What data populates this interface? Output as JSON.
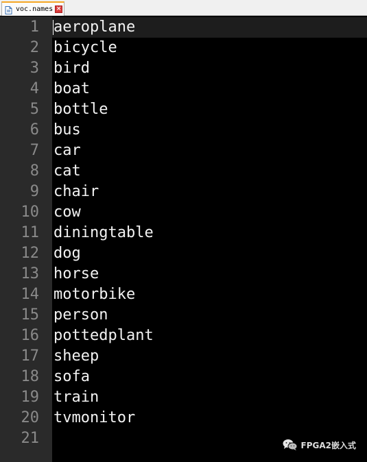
{
  "tab": {
    "filename": "voc.names",
    "icon": "file-icon",
    "close_icon": "close-icon",
    "close_glyph": "×"
  },
  "editor": {
    "lines": [
      {
        "number": "1",
        "text": "aeroplane"
      },
      {
        "number": "2",
        "text": "bicycle"
      },
      {
        "number": "3",
        "text": "bird"
      },
      {
        "number": "4",
        "text": "boat"
      },
      {
        "number": "5",
        "text": "bottle"
      },
      {
        "number": "6",
        "text": "bus"
      },
      {
        "number": "7",
        "text": "car"
      },
      {
        "number": "8",
        "text": "cat"
      },
      {
        "number": "9",
        "text": "chair"
      },
      {
        "number": "10",
        "text": "cow"
      },
      {
        "number": "11",
        "text": "diningtable"
      },
      {
        "number": "12",
        "text": "dog"
      },
      {
        "number": "13",
        "text": "horse"
      },
      {
        "number": "14",
        "text": "motorbike"
      },
      {
        "number": "15",
        "text": "person"
      },
      {
        "number": "16",
        "text": "pottedplant"
      },
      {
        "number": "17",
        "text": "sheep"
      },
      {
        "number": "18",
        "text": "sofa"
      },
      {
        "number": "19",
        "text": "train"
      },
      {
        "number": "20",
        "text": "tvmonitor"
      },
      {
        "number": "21",
        "text": ""
      }
    ],
    "current_line": 1,
    "colors": {
      "background": "#000000",
      "gutter": "#2a2a2a",
      "text": "#f2f2f2",
      "line_number": "#8a8a8a",
      "current_line": "#1d1d1d",
      "tab_accent": "#f5a623"
    }
  },
  "watermark": {
    "text": "FPGA2嵌入式",
    "icon": "wechat-icon"
  }
}
